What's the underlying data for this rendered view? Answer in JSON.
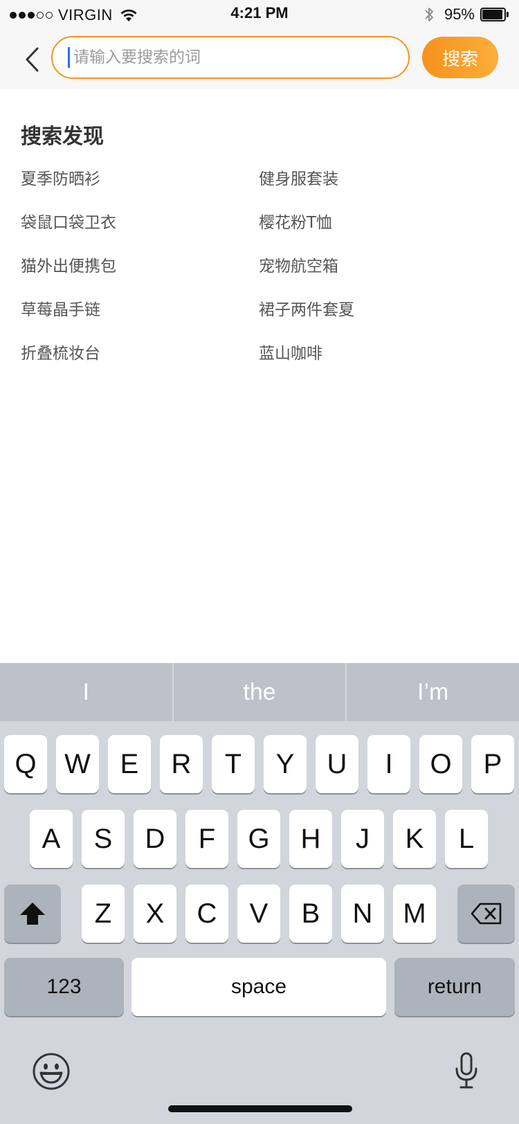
{
  "status_bar": {
    "carrier": "VIRGIN",
    "time": "4:21 PM",
    "battery_percent_label": "95%",
    "battery_level": 0.95,
    "signal_bars": 3,
    "signal_total": 5
  },
  "search": {
    "placeholder": "请输入要搜索的词",
    "value": "",
    "button_label": "搜索",
    "accent_color": "#f7931e"
  },
  "discover": {
    "title": "搜索发现",
    "items": [
      "夏季防晒衫",
      "健身服套装",
      "袋鼠口袋卫衣",
      "樱花粉T恤",
      "猫外出便携包",
      "宠物航空箱",
      "草莓晶手链",
      "裙子两件套夏",
      "折叠梳妆台",
      "蓝山咖啡"
    ]
  },
  "keyboard": {
    "suggestions": [
      "I",
      "the",
      "I’m"
    ],
    "row1": [
      "Q",
      "W",
      "E",
      "R",
      "T",
      "Y",
      "U",
      "I",
      "O",
      "P"
    ],
    "row2": [
      "A",
      "S",
      "D",
      "F",
      "G",
      "H",
      "J",
      "K",
      "L"
    ],
    "row3": [
      "Z",
      "X",
      "C",
      "V",
      "B",
      "N",
      "M"
    ],
    "numbers_label": "123",
    "space_label": "space",
    "return_label": "return"
  }
}
